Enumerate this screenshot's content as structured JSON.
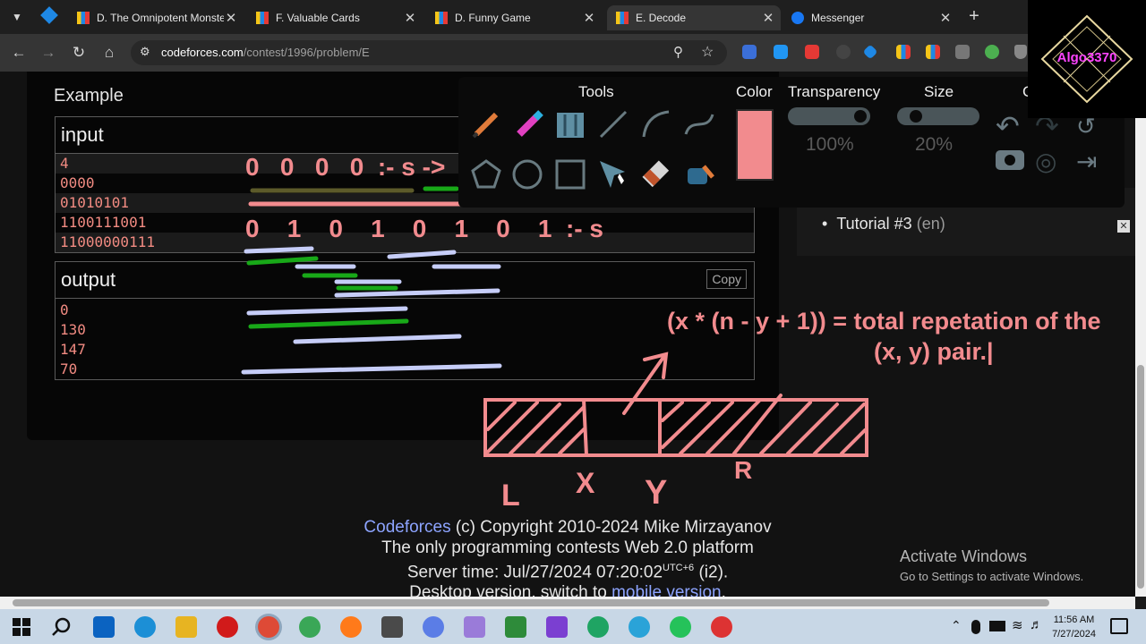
{
  "browser": {
    "tabs": [
      {
        "title": "D. The Omnipotent Monste",
        "icon": "codeforces-icon"
      },
      {
        "title": "F. Valuable Cards",
        "icon": "codeforces-icon"
      },
      {
        "title": "D. Funny Game",
        "icon": "codeforces-icon"
      },
      {
        "title": "E. Decode",
        "icon": "codeforces-icon",
        "active": true
      },
      {
        "title": "Messenger",
        "icon": "messenger-icon"
      }
    ],
    "url_host": "codeforces.com",
    "url_path": "/contest/1996/problem/E"
  },
  "example": {
    "title": "Example",
    "input_label": "input",
    "input_lines": [
      "4",
      "0000",
      "01010101",
      "1100111001",
      "11000000111"
    ],
    "output_label": "output",
    "copy_label": "Copy",
    "output_lines": [
      "0",
      "130",
      "147",
      "70"
    ]
  },
  "sidebar": {
    "tutorial": "Tutorial #3",
    "tutorial_lang": "(en)"
  },
  "footer": {
    "brand": "Codeforces",
    "copyright": " (c) Copyright 2010-2024 Mike Mirzayanov",
    "tagline": "The only programming contests Web 2.0 platform",
    "server_time": "Server time: Jul/27/2024 07:20:02",
    "tz": "UTC+6",
    "instance": " (i2).",
    "desktop": "Desktop version, switch to ",
    "mobile_link": "mobile version",
    "dot": "."
  },
  "activate_windows": {
    "title": "Activate Windows",
    "subtitle": "Go to Settings to activate Windows."
  },
  "annotation_tool": {
    "tools_label": "Tools",
    "color_label": "Color",
    "transparency_label": "Transparency",
    "transparency_value": "100%",
    "size_label": "Size",
    "size_value": "20%",
    "partial_label": "C",
    "color": "#f28b8e"
  },
  "annotations": {
    "row1": "0   0   0   0  :- s ->",
    "row2": "0    1    0    1    0    1    0    1  :- s",
    "formula1": "(x * (n - y + 1)) = total repetation of the",
    "formula2": "(x, y) pair.|",
    "L": "L",
    "X": "X",
    "Y": "Y",
    "R": "R"
  },
  "logo": {
    "text": "Algo3370"
  },
  "taskbar": {
    "time": "11:56 AM",
    "date": "7/27/2024"
  }
}
